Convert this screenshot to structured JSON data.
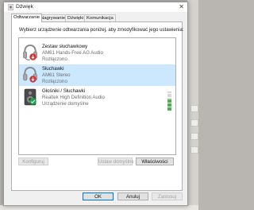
{
  "window": {
    "title": "Dźwięk",
    "close_glyph": "✕"
  },
  "tabs": [
    {
      "label": "Odtwarzanie",
      "active": true
    },
    {
      "label": "Nagrywanie",
      "active": false
    },
    {
      "label": "Dźwięki",
      "active": false
    },
    {
      "label": "Komunikacja",
      "active": false
    }
  ],
  "playback": {
    "hint": "Wybierz urządzenie odtwarzania poniżej, aby zmodyfikować jego ustawienia:",
    "devices": [
      {
        "name": "Zestaw słuchawkowy",
        "description": "AM61 Hands-Free AG Audio",
        "status": "Rozłączono",
        "icon": "headset-icon",
        "badge": "disconnected-badge-icon",
        "selected": false
      },
      {
        "name": "Słuchawki",
        "description": "AM61 Stereo",
        "status": "Rozłączono",
        "icon": "headphones-icon",
        "badge": "disconnected-badge-icon",
        "selected": true
      },
      {
        "name": "Głośniki / Słuchawki",
        "description": "Realtek High Definition Audio",
        "status": "Urządzenie domyślne",
        "icon": "speaker-icon",
        "badge": "default-check-badge-icon",
        "selected": false,
        "level_meter": {
          "segments": 10,
          "lit": 6
        }
      }
    ]
  },
  "buttons": {
    "configure": "Konfiguruj",
    "set_default": "Ustaw domyślne",
    "properties": "Właściwości",
    "ok": "OK",
    "cancel": "Anuluj",
    "apply": "Zastosuj"
  },
  "colors": {
    "selection": "#cce8ff",
    "accent": "#0078d7",
    "disconnected": "#d13438",
    "default_check": "#16a34a",
    "meter_on": "#4caf50"
  }
}
